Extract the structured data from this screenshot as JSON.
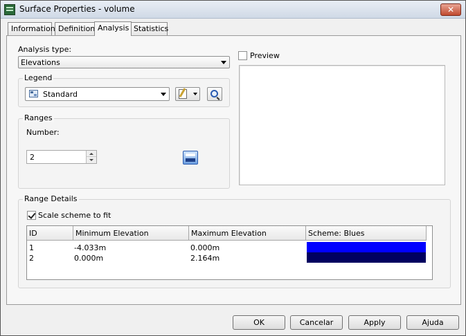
{
  "window": {
    "title": "Surface Properties - volume",
    "close_label": "✕"
  },
  "tabs": [
    {
      "label": "Information"
    },
    {
      "label": "Definition"
    },
    {
      "label": "Analysis"
    },
    {
      "label": "Statistics"
    }
  ],
  "analysis": {
    "type_label": "Analysis type:",
    "type_value": "Elevations",
    "preview_label": "Preview",
    "preview_checked": false
  },
  "legend": {
    "group_title": "Legend",
    "value": "Standard"
  },
  "ranges": {
    "group_title": "Ranges",
    "number_label": "Number:",
    "number_value": "2"
  },
  "range_details": {
    "group_title": "Range Details",
    "scale_label": "Scale scheme to fit",
    "scale_checked": true,
    "columns": [
      "ID",
      "Minimum Elevation",
      "Maximum Elevation",
      "Scheme: Blues"
    ],
    "rows": [
      {
        "id": "1",
        "min": "-4.033m",
        "max": "0.000m",
        "color": "#0000ff"
      },
      {
        "id": "2",
        "min": "0.000m",
        "max": "2.164m",
        "color": "#000060"
      }
    ]
  },
  "buttons": {
    "ok": "OK",
    "cancel": "Cancelar",
    "apply": "Apply",
    "help": "Ajuda"
  }
}
